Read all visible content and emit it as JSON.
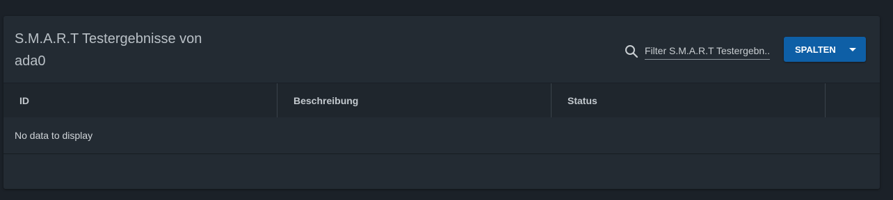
{
  "card": {
    "title_line1": "S.M.A.R.T Testergebnisse von",
    "title_line2": "ada0"
  },
  "filter": {
    "placeholder": "Filter S.M.A.R.T Testergebn...",
    "value": "",
    "icon": "search-icon"
  },
  "columns_button": {
    "label": "SPALTEN",
    "icon": "caret-down-icon",
    "color": "#0e5fa6"
  },
  "table": {
    "headers": [
      "ID",
      "Beschreibung",
      "Status"
    ],
    "empty_message": "No data to display"
  }
}
